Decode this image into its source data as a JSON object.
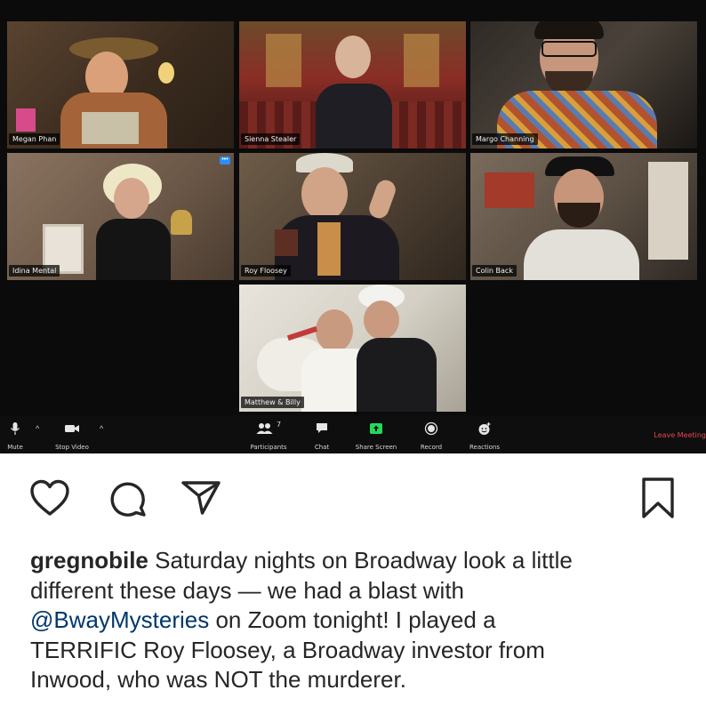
{
  "zoom": {
    "participants": [
      {
        "name": "Megan Phan"
      },
      {
        "name": "Sienna Stealer"
      },
      {
        "name": "Margo Channing"
      },
      {
        "name": "Idina Mental"
      },
      {
        "name": "Roy Floosey"
      },
      {
        "name": "Colin Back"
      },
      {
        "name": "Matthew & Billy"
      }
    ],
    "toolbar": {
      "mute": "Mute",
      "stop_video": "Stop Video",
      "participants": "Participants",
      "participants_count": "7",
      "chat": "Chat",
      "share_screen": "Share Screen",
      "record": "Record",
      "reactions": "Reactions",
      "leave": "Leave Meeting"
    },
    "colors": {
      "active_border": "#e7d56b",
      "share_green": "#23d959",
      "leave_red": "#e5484d"
    }
  },
  "post": {
    "icons": [
      "heart-icon",
      "comment-icon",
      "share-icon",
      "bookmark-icon"
    ],
    "username": "gregnobile",
    "caption_lines": [
      "Saturday nights on Broadway look a little",
      "different these days — we had a blast with",
      "on Zoom tonight! I played a",
      "TERRIFIC Roy Floosey, a Broadway investor from",
      "Inwood, who was NOT the murderer."
    ],
    "mention": "@BwayMysteries"
  }
}
